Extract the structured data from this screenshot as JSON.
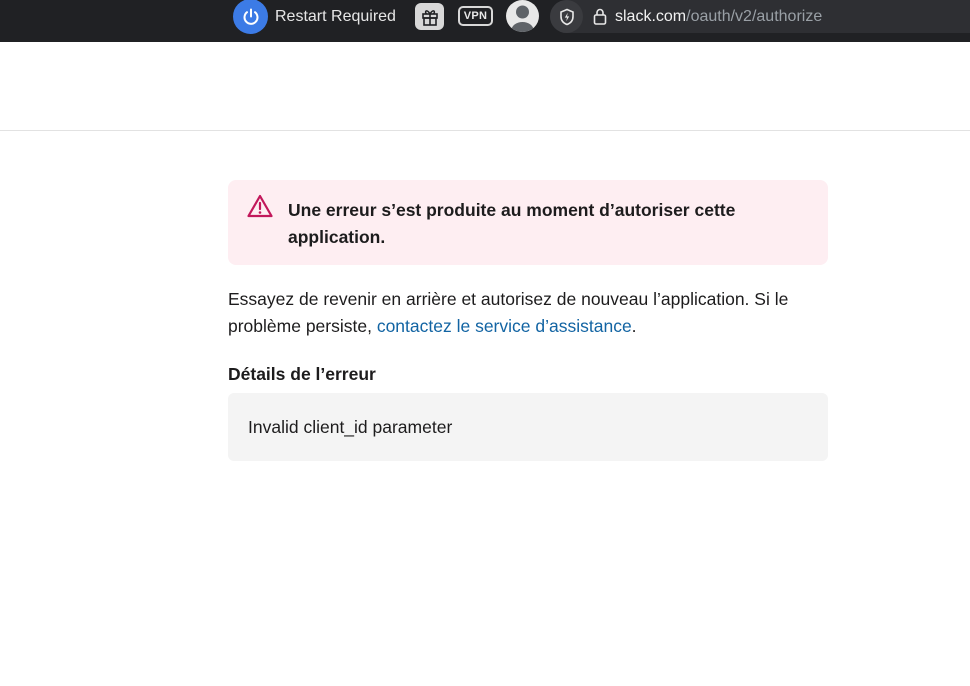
{
  "browser": {
    "restart_label": "Restart Required",
    "vpn_label": "VPN",
    "url_host": "slack.com",
    "url_path": "/oauth/v2/authorize",
    "icons": [
      "power-icon",
      "gift-icon",
      "vpn-badge",
      "avatar-icon",
      "shield-icon",
      "lock-icon"
    ]
  },
  "alert": {
    "message": "Une erreur s’est produite au moment d’autoriser cette application.",
    "icon": "warning-icon",
    "color": "#e01e5a"
  },
  "help": {
    "text_before": "Essayez de revenir en arrière et autorisez de nouveau l’application. Si le problème persiste, ",
    "link_text": "contactez le service d’assistance",
    "text_after": "."
  },
  "details": {
    "heading": "Détails de l’erreur",
    "message": "Invalid client_id parameter"
  },
  "colors": {
    "link": "#1264a3",
    "alert_bg": "#feeef2",
    "details_bg": "#f4f4f4",
    "toolbar_bg": "#202124"
  }
}
